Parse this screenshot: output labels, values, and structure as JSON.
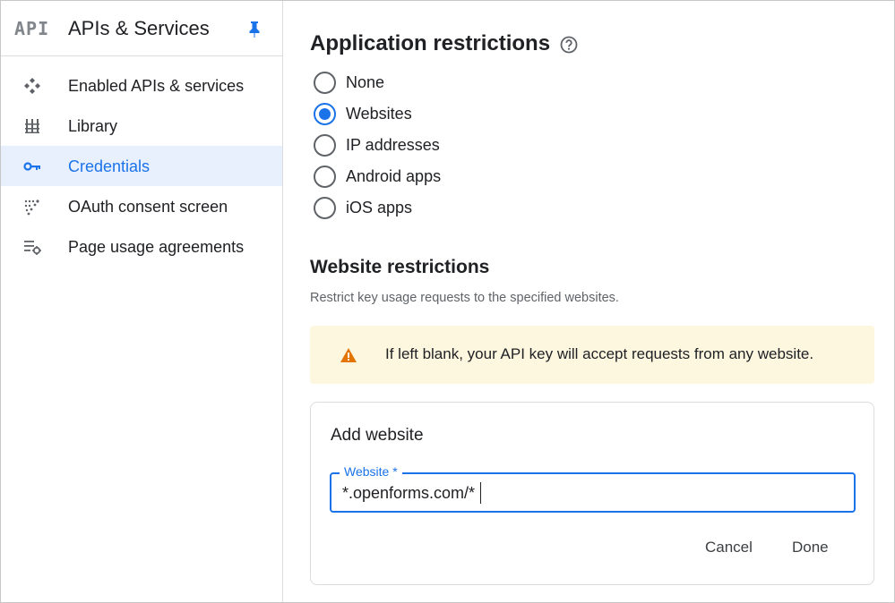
{
  "sidebar": {
    "logo": "API",
    "title": "APIs & Services",
    "items": [
      {
        "label": "Enabled APIs & services",
        "icon": "enabled-apis-icon",
        "active": false
      },
      {
        "label": "Library",
        "icon": "library-icon",
        "active": false
      },
      {
        "label": "Credentials",
        "icon": "key-icon",
        "active": true
      },
      {
        "label": "OAuth consent screen",
        "icon": "oauth-icon",
        "active": false
      },
      {
        "label": "Page usage agreements",
        "icon": "settings-list-icon",
        "active": false
      }
    ]
  },
  "main": {
    "app_restrictions": {
      "heading": "Application restrictions",
      "options": [
        "None",
        "Websites",
        "IP addresses",
        "Android apps",
        "iOS apps"
      ],
      "selected": "Websites"
    },
    "website_restrictions": {
      "heading": "Website restrictions",
      "description": "Restrict key usage requests to the specified websites.",
      "warning": "If left blank, your API key will accept requests from any website."
    },
    "add_website": {
      "title": "Add website",
      "field_label": "Website *",
      "field_value": "*.openforms.com/*",
      "cancel_label": "Cancel",
      "done_label": "Done"
    }
  },
  "colors": {
    "accent": "#1a73e8",
    "active_bg": "#e8f0fe",
    "warning_bg": "#fef7e0",
    "warning_icon": "#e37400"
  }
}
